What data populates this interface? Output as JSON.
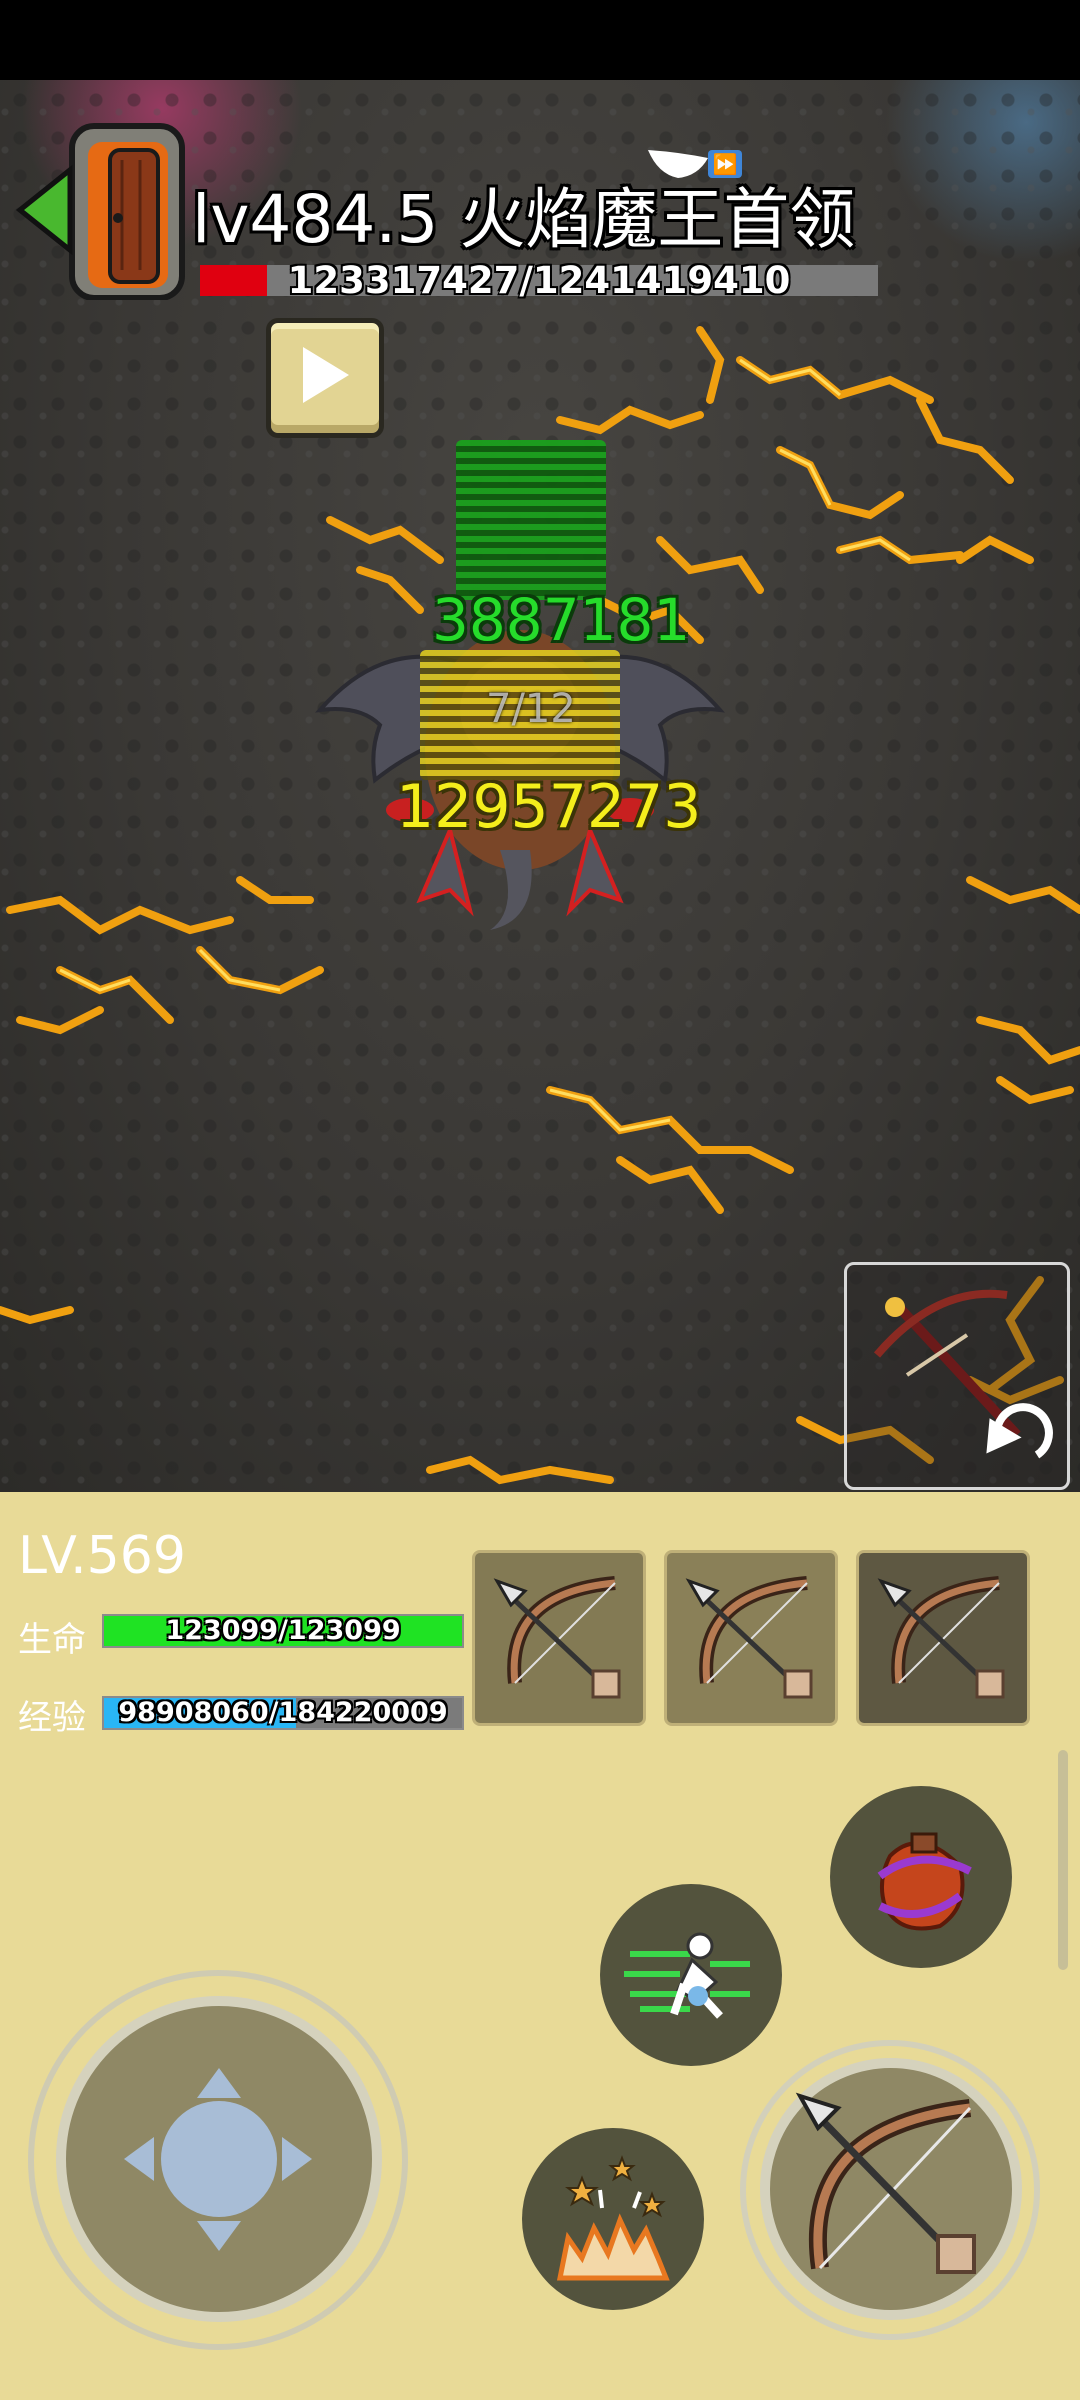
{
  "boss": {
    "title": "lv484.5 火焰魔王首领",
    "hp_text": "123317427/1241419410",
    "hp_fraction": 0.0993
  },
  "battle": {
    "green_damage": "3887181",
    "yellow_damage": "12957273",
    "boss_counter": "7/12"
  },
  "player": {
    "level": "LV.569",
    "hp_label": "生命",
    "hp_text": "123099/123099",
    "hp_fraction": 1.0,
    "exp_label": "经验",
    "exp_text": "98908060/184220009",
    "exp_fraction": 0.537
  },
  "weapon_slots": [
    "bow-icon",
    "bow-icon",
    "bow-icon"
  ],
  "skills": [
    "potion-icon",
    "dash-icon",
    "burst-icon",
    "bow-attack-icon"
  ],
  "colors": {
    "hud_bg": "#e8da97",
    "hp_green": "#1fe323",
    "exp_blue": "#29b6f5",
    "boss_hp_red": "#e00010",
    "damage_green": "#26dc2b",
    "damage_yellow": "#f4ee1c"
  }
}
